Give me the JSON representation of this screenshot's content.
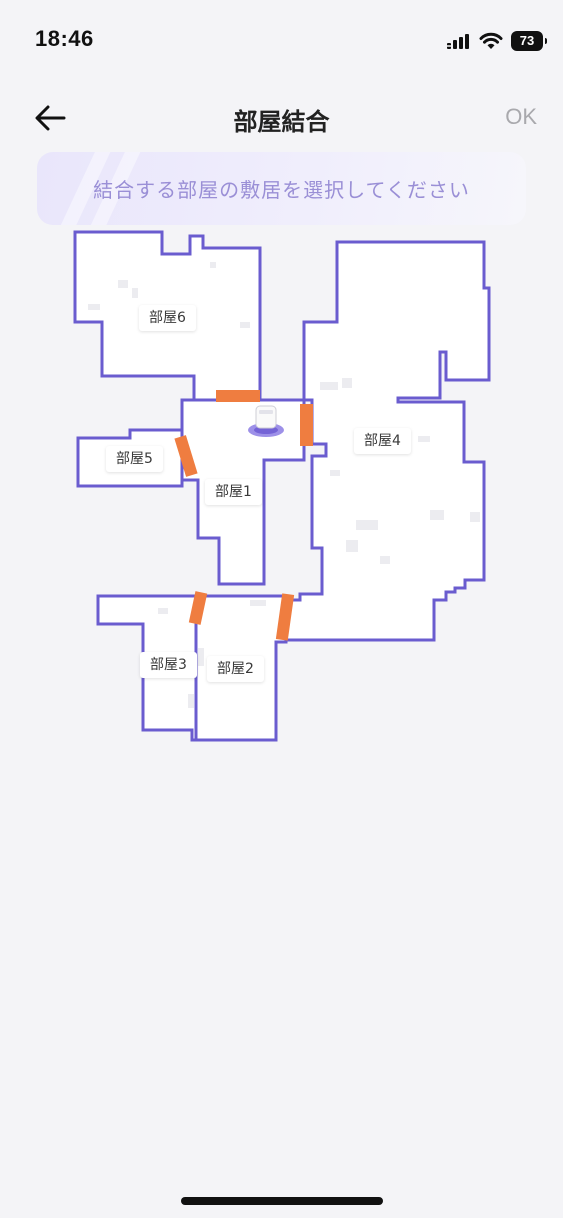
{
  "status_bar": {
    "time": "18:46",
    "battery": "73"
  },
  "nav": {
    "title": "部屋結合",
    "ok_label": "OK"
  },
  "hint": {
    "text": "結合する部屋の敷居を選択してください"
  },
  "map": {
    "outline_color": "#6a5ccf",
    "divider_color": "#ef7d40",
    "rooms": [
      {
        "label": "部屋6"
      },
      {
        "label": "部屋4"
      },
      {
        "label": "部屋5"
      },
      {
        "label": "部屋1"
      },
      {
        "label": "部屋3"
      },
      {
        "label": "部屋2"
      }
    ]
  }
}
